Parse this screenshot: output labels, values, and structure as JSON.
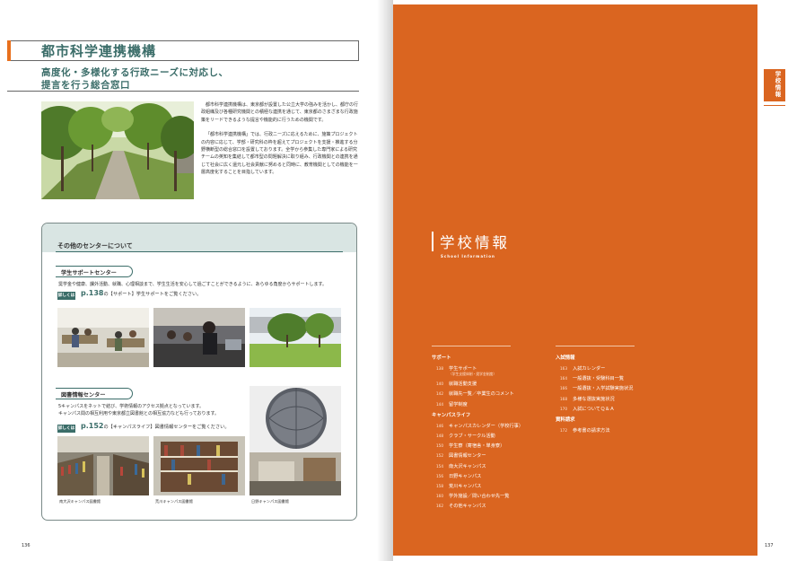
{
  "left_page": {
    "title": "都市科学連携機構",
    "subtitle_line1": "高度化・多様化する行政ニーズに対応し、",
    "subtitle_line2": "提言を行う総合窓口",
    "intro_p1": "都市科学連携機構は、東京都が設置した公立大学の強みを活かし、都庁の行政組織及び各種研究機関との積極な連携を通じて、東京都のさまざまな行政施策をリードできるような提言や機能的に行うための機関です。",
    "intro_p2": "「都市科学連携機構」では、行政ニーズに応えるために、施策プロジェクトの内容に応じて、学部・研究科の枠を超えてプロジェクトを支援・推進する分野横断型の総合窓口を設置しております。全学から参集した専門家による研究チームの英知を集結して都市型の問題解決に取り組み、行政機関との連携を通じて社会に広く還元し社会貢献に努めると同時に、教育機関としての機能を一層高度化することを目指しています。",
    "centers_title": "その他のセンターについて",
    "support": {
      "label": "学生サポートセンター",
      "text": "奨学金や健康、課外活動、就職、心理相談まで、学生生活を安心して過ごすことができるように、あらゆる角度からサポートします。",
      "see_label": "詳しくは",
      "page": "p.138",
      "see_text": "の【サポート】学生サポートをご覧ください。"
    },
    "library": {
      "label": "図書情報センター",
      "text_line1": "5キャンパスをネットで結び、学術情報のアクセス拠点となっています。",
      "text_line2": "キャンパス間の相互利用や東京都立図書館との相互協力なども行っております。",
      "see_label": "詳しくは",
      "page": "p.152",
      "see_text": "の【キャンパスライフ】図書情報センターをご覧ください。",
      "captions": [
        "南大沢キャンパス図書館",
        "荒川キャンパス図書館",
        "日野キャンパス図書館"
      ]
    },
    "page_number": "136"
  },
  "right_page": {
    "tab_label": "学校情報",
    "section_title": "学校情報",
    "section_en": "School Information",
    "page_number": "137",
    "toc_left": [
      {
        "head": "サポート"
      },
      {
        "page": "138",
        "label": "学生サポート",
        "sub": "（学生支援体制・奨学金制度）"
      },
      {
        "page": "140",
        "label": "就職活動支援"
      },
      {
        "page": "142",
        "label": "就職先一覧／卒業生のコメント"
      },
      {
        "page": "144",
        "label": "留学制度"
      },
      {
        "head": "キャンパスライフ"
      },
      {
        "page": "146",
        "label": "キャンパスカレンダー（学校行事）"
      },
      {
        "page": "148",
        "label": "クラブ・サークル活動"
      },
      {
        "page": "150",
        "label": "学生寮（寄宿舎・単身寮）"
      },
      {
        "page": "152",
        "label": "図書情報センター"
      },
      {
        "page": "154",
        "label": "南大沢キャンパス"
      },
      {
        "page": "156",
        "label": "日野キャンパス"
      },
      {
        "page": "158",
        "label": "荒川キャンパス"
      },
      {
        "page": "160",
        "label": "学外施設／問い合わせ先一覧"
      },
      {
        "page": "162",
        "label": "その他キャンパス"
      }
    ],
    "toc_right": [
      {
        "head": "入試情報"
      },
      {
        "page": "163",
        "label": "入試カレンダー"
      },
      {
        "page": "164",
        "label": "一般選抜・受験科目一覧"
      },
      {
        "page": "166",
        "label": "一般選抜・入学試験実施状況"
      },
      {
        "page": "168",
        "label": "多様な選抜実施状況"
      },
      {
        "page": "170",
        "label": "入試についてＱ＆Ａ"
      },
      {
        "head": "資料請求"
      },
      {
        "page": "172",
        "label": "参考書の請求方法"
      }
    ]
  },
  "colors": {
    "accent_orange": "#da6520",
    "accent_teal": "#3b6d69"
  }
}
